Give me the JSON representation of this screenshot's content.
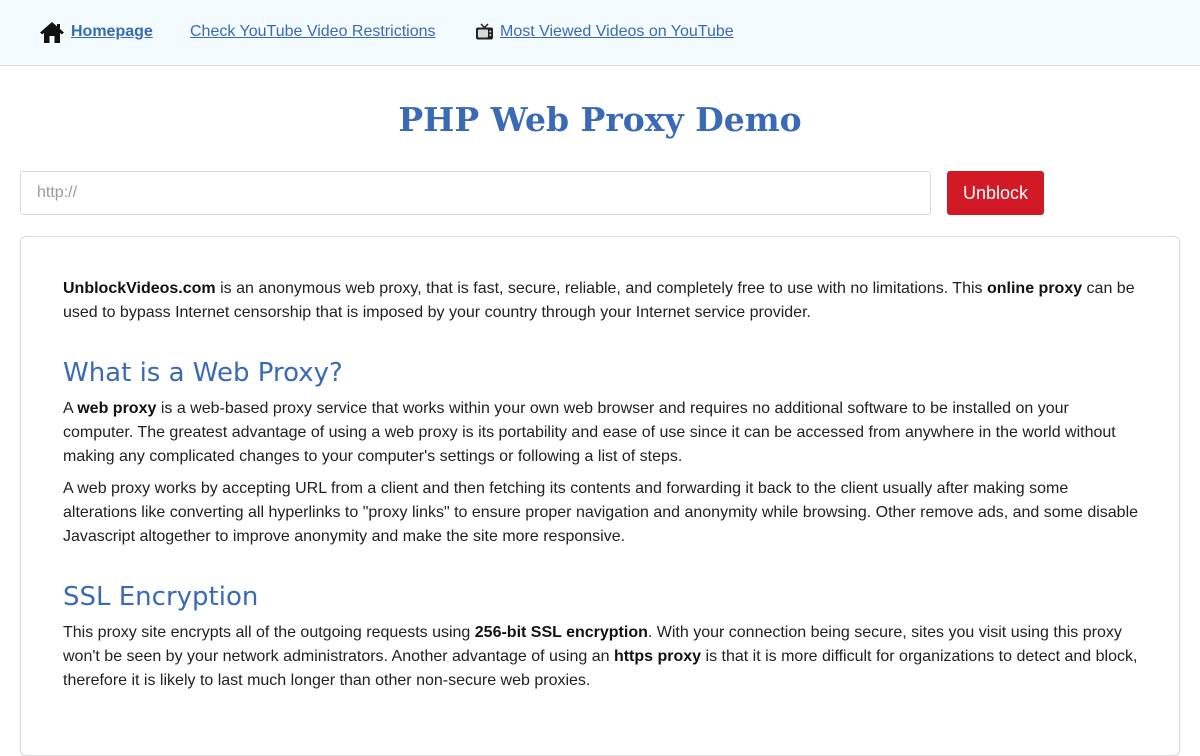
{
  "nav": {
    "home": "Homepage",
    "restrictions": "Check YouTube Video Restrictions",
    "most_viewed": "Most Viewed Videos on YouTube",
    "icons": [
      "home-icon",
      "tv-icon"
    ]
  },
  "title": "PHP Web Proxy Demo",
  "form": {
    "url_placeholder": "http://",
    "url_value": "",
    "submit_label": "Unblock"
  },
  "colors": {
    "accent": "#3a6ab5",
    "button": "#d11a25",
    "nav_bg": "#f4fbfe"
  },
  "content": {
    "intro": {
      "brand": "UnblockVideos.com",
      "text1": " is an anonymous web proxy, that is fast, secure, reliable, and completely free to use with no limitations. This ",
      "bold1": "online proxy",
      "text2": " can be used to bypass Internet censorship that is imposed by your country through your Internet service provider."
    },
    "web_proxy": {
      "heading": "What is a Web Proxy?",
      "p1_text1": "A ",
      "p1_bold": "web proxy",
      "p1_text2": " is a web-based proxy service that works within your own web browser and requires no additional software to be installed on your computer. The greatest advantage of using a web proxy is its portability and ease of use since it can be accessed from anywhere in the world without making any complicated changes to your computer's settings or following a list of steps.",
      "p2": "A web proxy works by accepting URL from a client and then fetching its contents and forwarding it back to the client usually after making some alterations like converting all hyperlinks to \"proxy links\" to ensure proper navigation and anonymity while browsing. Other remove ads, and some disable Javascript altogether to improve anonymity and make the site more responsive."
    },
    "ssl": {
      "heading": "SSL Encryption",
      "text1": "This proxy site encrypts all of the outgoing requests using ",
      "bold1": "256-bit SSL encryption",
      "text2": ". With your connection being secure, sites you visit using this proxy won't be seen by your network administrators. Another advantage of using an ",
      "bold2": "https proxy",
      "text3": " is that it is more difficult for organizations to detect and block, therefore it is likely to last much longer than other non-secure web proxies."
    }
  }
}
